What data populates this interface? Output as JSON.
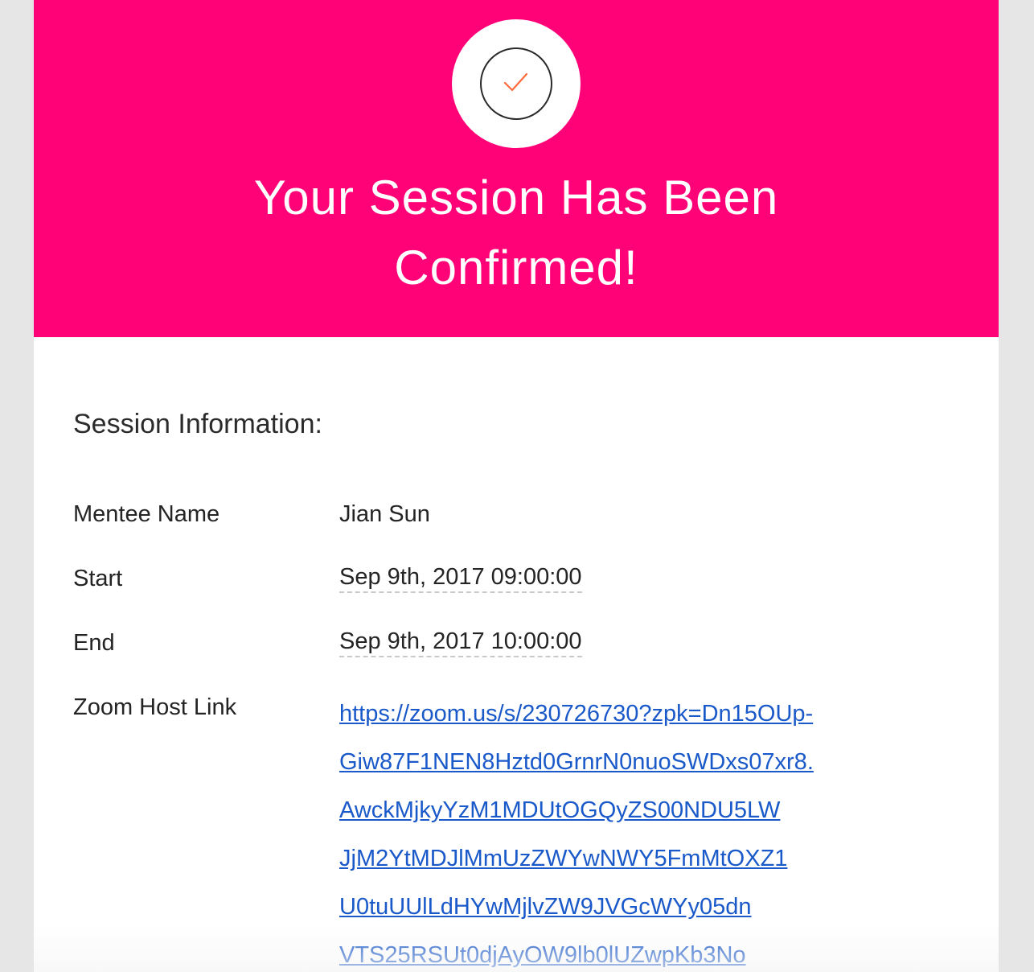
{
  "hero": {
    "icon": "checkmark-icon",
    "title_line1": "Your Session Has Been",
    "title_line2": "Confirmed!",
    "background": "#ff0277"
  },
  "session": {
    "heading": "Session Information:",
    "rows": [
      {
        "label": "Mentee Name",
        "value": "Jian Sun"
      },
      {
        "label": "Start",
        "value": "Sep 9th, 2017 09:00:00"
      },
      {
        "label": "End",
        "value": "Sep 9th, 2017 10:00:00"
      },
      {
        "label": "Zoom Host Link"
      }
    ],
    "zoom_link_lines": [
      "https://zoom.us/s/230726730?zpk=Dn15OUp-",
      "Giw87F1NEN8Hztd0GrnrN0nuoSWDxs07xr8.",
      "AwckMjkyYzM1MDUtOGQyZS00NDU5LW",
      "JjM2YtMDJlMmUzZWYwNWY5FmMtOXZ1",
      "U0tuUUlLdHYwMjlvZW9JVGcWYy05dn",
      "VTS25RSUt0djAyOW9lb0lUZwpKb3No"
    ]
  }
}
